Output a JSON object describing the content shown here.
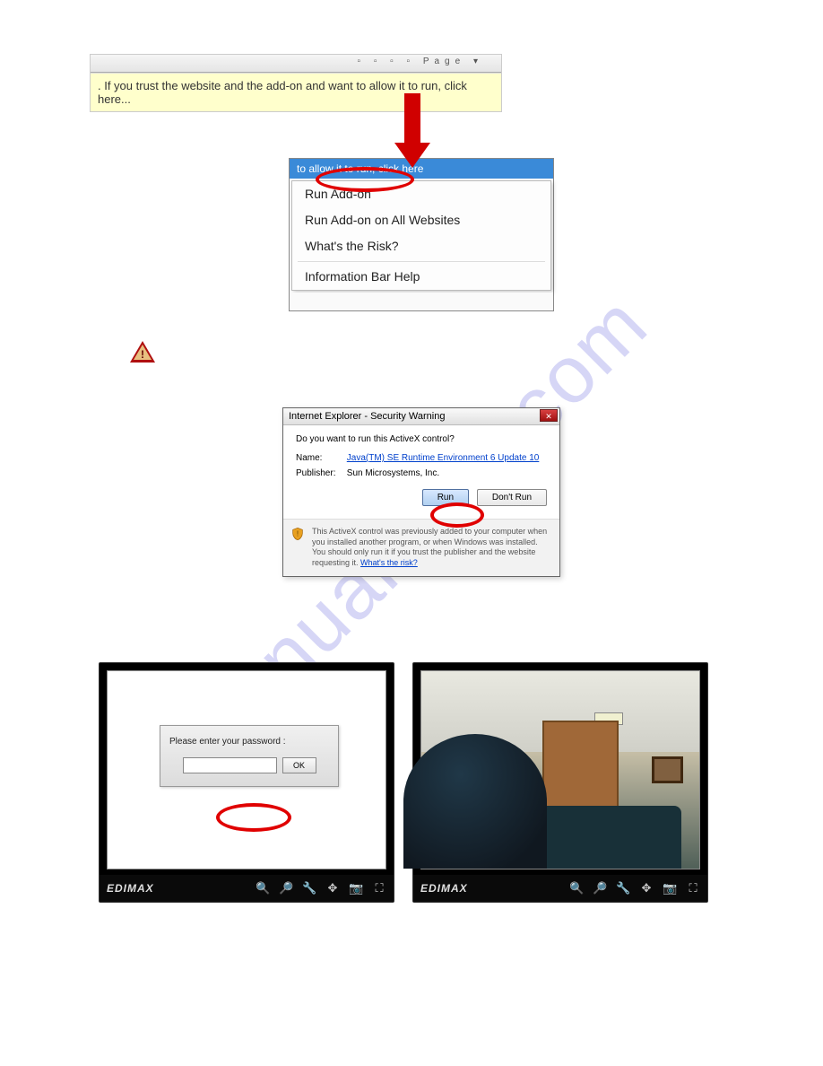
{
  "watermark": "manualslive.com",
  "infobar": {
    "message": ". If you trust the website and the add-on and want to allow it to run, click here...",
    "page_menu": "Page"
  },
  "context_menu": {
    "header": "to allow it to run, click here",
    "items": [
      "Run Add-on",
      "Run Add-on on All Websites",
      "What's the Risk?",
      "Information Bar Help"
    ]
  },
  "security_dialog": {
    "title": "Internet Explorer - Security Warning",
    "question": "Do you want to run this ActiveX control?",
    "name_label": "Name:",
    "name_value": "Java(TM) SE Runtime Environment 6 Update 10",
    "publisher_label": "Publisher:",
    "publisher_value": "Sun Microsystems, Inc.",
    "run_btn": "Run",
    "dont_run_btn": "Don't Run",
    "footer_text": "This ActiveX control was previously added to your computer when you installed another program, or when Windows was installed. You should only run it if you trust the publisher and the website requesting it.",
    "footer_link": "What's the risk?"
  },
  "password_dialog": {
    "label": "Please enter your password :",
    "ok": "OK"
  },
  "viewer": {
    "brand": "EDIMAX"
  }
}
